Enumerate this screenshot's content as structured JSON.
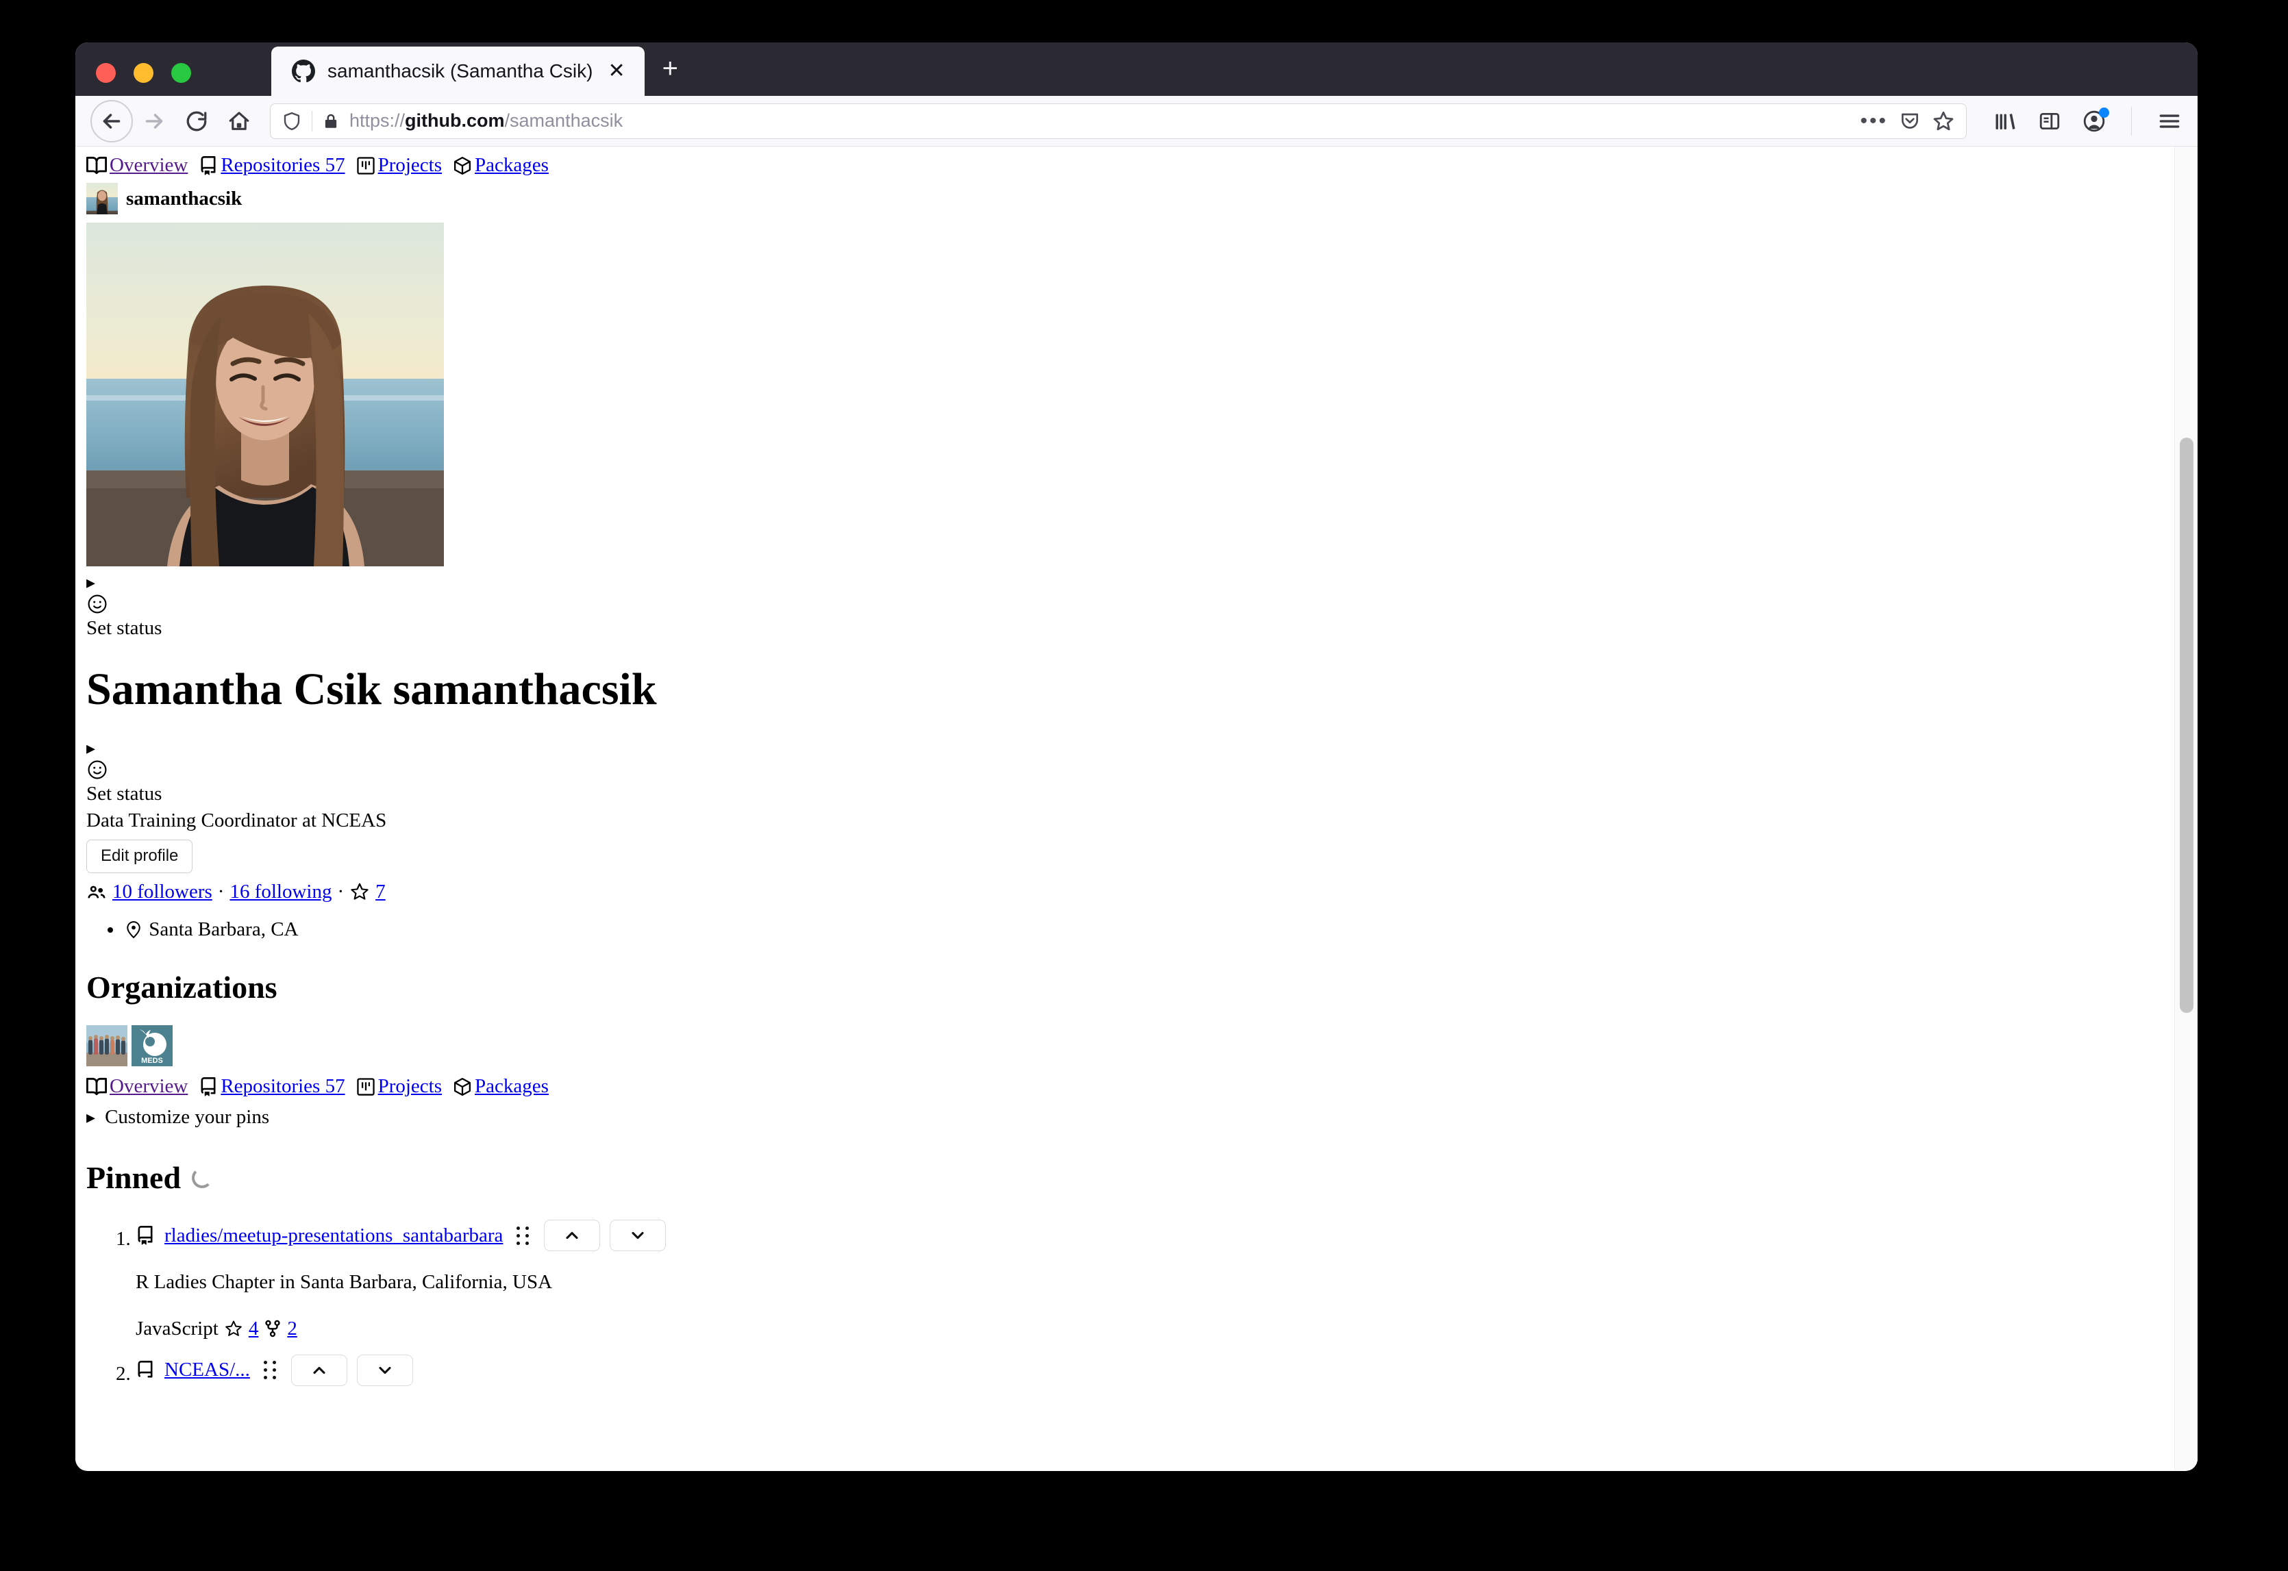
{
  "browser": {
    "tab": {
      "title": "samanthacsik (Samantha Csik)",
      "favicon": "github-icon",
      "close_label": "✕"
    },
    "new_tab_label": "+",
    "url": {
      "scheme_prefix": "https://",
      "host": "github.com",
      "path": "/samanthacsik",
      "full": "https://github.com/samanthacsik"
    },
    "overflow_label": "•••"
  },
  "page": {
    "nav": {
      "overview": "Overview",
      "repositories": "Repositories 57",
      "projects": "Projects",
      "packages": "Packages"
    },
    "user_handle": "samanthacsik",
    "status": {
      "triangle": "▸",
      "set_status": "Set status"
    },
    "profile": {
      "full_name": "Samantha Csik samanthacsik",
      "bio": "Data Training Coordinator at NCEAS",
      "edit_button": "Edit profile",
      "followers": "10 followers",
      "separator": "·",
      "following": "16 following",
      "stars": "7",
      "location": "Santa Barbara, CA"
    },
    "organizations": {
      "heading": "Organizations",
      "items": [
        {
          "name": "rladies-santa-barbara-avatar"
        },
        {
          "name": "meds-avatar",
          "label": "MEDS"
        }
      ]
    },
    "customize_pins": {
      "triangle": "▸",
      "label": "Customize your pins"
    },
    "pinned": {
      "heading": "Pinned",
      "loading": "loading-spinner",
      "items": [
        {
          "index": "1.",
          "repo": "rladies/meetup-presentations_santabarbara",
          "description": "R Ladies Chapter in Santa Barbara, California, USA",
          "language": "JavaScript",
          "stars": "4",
          "forks": "2",
          "move_up": "⌃",
          "move_down": "⌄"
        },
        {
          "index": "2.",
          "repo": "NCEAS/...",
          "description": "",
          "language": "",
          "stars": "",
          "forks": "",
          "move_up": "⌃",
          "move_down": "⌄"
        }
      ]
    }
  },
  "colors": {
    "link": "#0000ee",
    "visited_link": "#551a8b",
    "titlebar": "#2b2a33",
    "chrome": "#f9f9fb",
    "accent_dot": "#0a84ff"
  }
}
